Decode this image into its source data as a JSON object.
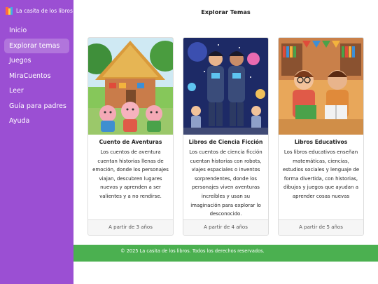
{
  "sidebar": {
    "brand_name": "La casita de los libros",
    "items": [
      {
        "label": "Inicio"
      },
      {
        "label": "Explorar temas",
        "active": true
      },
      {
        "label": "Juegos"
      },
      {
        "label": "MiraCuentos"
      },
      {
        "label": "Leer"
      },
      {
        "label": "Guía para padres"
      },
      {
        "label": "Ayuda"
      }
    ]
  },
  "main": {
    "title": "Explorar Temas",
    "cards": [
      {
        "title": "Cuento de Aventuras",
        "text": "Los cuentos de aventura cuentan historias llenas de emoción, donde los personajes viajan, descubren lugares nuevos y aprenden a ser valientes y a no rendirse.",
        "age": "A partir de 3 años",
        "image_icon": "three-pigs-illustration"
      },
      {
        "title": "Libros de Ciencia Ficción",
        "text": "Los cuentos de ciencia ficción cuentan historias con robots, viajes espaciales o inventos sorprendentes, donde los personajes viven aventuras increíbles y usan su imaginación para explorar lo desconocido.",
        "age": "A partir de 4 años",
        "image_icon": "space-kids-illustration"
      },
      {
        "title": "Libros Educativos",
        "text": "Los libros educativos enseñan matemáticas, ciencias, estudios sociales y lenguaje de forma divertida, con historias, dibujos y juegos que ayudan a aprender cosas nuevas",
        "age": "A partir de 5 años",
        "image_icon": "reading-kids-illustration"
      }
    ]
  },
  "footer": {
    "text": "© 2025 La casita de los libros. Todos los derechos reservados."
  },
  "colors": {
    "sidebar": "#9b4fd3",
    "footer": "#4bb050"
  }
}
